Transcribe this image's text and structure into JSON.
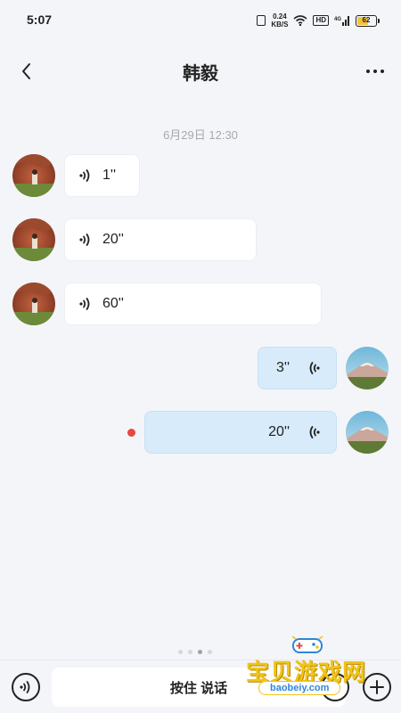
{
  "status": {
    "time": "5:07",
    "net_speed_value": "0.24",
    "net_speed_unit": "KB/S",
    "hd": "HD",
    "signal_label": "4G",
    "battery": "62"
  },
  "header": {
    "title": "韩毅"
  },
  "chat": {
    "timestamp": "6月29日 12:30",
    "messages": [
      {
        "direction": "incoming",
        "duration": "1''"
      },
      {
        "direction": "incoming",
        "duration": "20''"
      },
      {
        "direction": "incoming",
        "duration": "60''"
      },
      {
        "direction": "outgoing",
        "duration": "3''"
      },
      {
        "direction": "outgoing",
        "duration": "20''",
        "unread": true
      }
    ]
  },
  "input_bar": {
    "hold_to_talk_label": "按住 说话",
    "icons": [
      "voice-toggle-icon",
      "emoji-icon",
      "plus-icon"
    ]
  },
  "watermark": {
    "title": "宝贝游戏网",
    "url": "baobeiy.com"
  },
  "colors": {
    "background": "#f4f5f9",
    "incoming_bubble": "#ffffff",
    "outgoing_bubble": "#d7ebfa",
    "unread_dot": "#e5483f",
    "watermark_yellow": "#f2c318"
  }
}
